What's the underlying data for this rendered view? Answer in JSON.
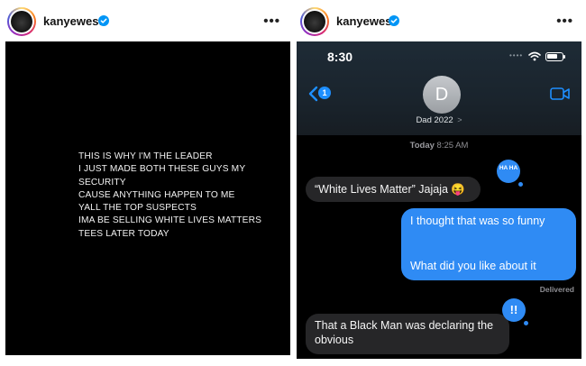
{
  "left_post": {
    "username": "kanyewest",
    "caption_lines": [
      "THIS IS WHY I'M THE LEADER",
      "I JUST MADE BOTH THESE GUYS MY",
      "SECURITY",
      "CAUSE ANYTHING HAPPEN TO ME",
      "YALL THE TOP SUSPECTS",
      "IMA BE SELLING WHITE LIVES MATTERS",
      "TEES LATER TODAY"
    ]
  },
  "right_post": {
    "username": "kanyewest",
    "phone": {
      "status_time": "8:30",
      "status_dots": "••••",
      "back_badge": "1",
      "contact_initial": "D",
      "contact_name": "Dad 2022",
      "contact_chevron": ">",
      "timestamp_day": "Today",
      "timestamp_time": "8:25 AM",
      "messages": [
        {
          "side": "received",
          "text": "“White Lives Matter” Jajaja 😝",
          "tapback": "HA HA"
        },
        {
          "side": "sent",
          "text_1": "I thought that was so funny",
          "text_2": "What did you like about it"
        },
        {
          "side": "received",
          "text": "That a Black Man was declaring the obvious",
          "tapback": "!!"
        }
      ],
      "delivered_label": "Delivered"
    }
  },
  "colors": {
    "imessage_blue": "#2f8bf4",
    "received_bubble": "#262628",
    "verified_blue": "#0095f6"
  },
  "icons": [
    "verified-badge-icon",
    "more-options-icon",
    "wifi-icon",
    "battery-icon",
    "back-chevron-icon",
    "facetime-video-icon"
  ]
}
